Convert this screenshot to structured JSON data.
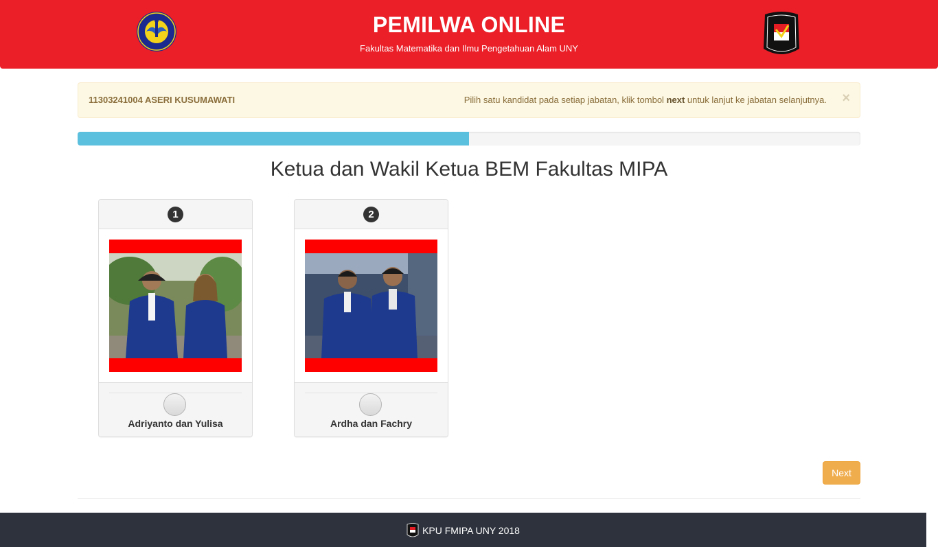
{
  "header": {
    "title": "PEMILWA ONLINE",
    "subtitle": "Fakultas Matematika dan Ilmu Pengetahuan Alam UNY",
    "left_logo_text": "UNIVERSITAS NEGERI YOGYAKARTA",
    "right_logo_text": "PEMILIHAN KOMISI UMUM FMIPA"
  },
  "alert": {
    "user": "11303241004 ASERI KUSUMAWATI",
    "message_before": "Pilih satu kandidat pada setiap jabatan, klik tombol ",
    "message_bold": "next",
    "message_after": " untuk lanjut ke jabatan selanjutnya.",
    "close_label": "×"
  },
  "progress": {
    "value_percent": 50
  },
  "section": {
    "title": "Ketua dan Wakil Ketua BEM Fakultas MIPA"
  },
  "candidates": [
    {
      "number": "1",
      "name": "Adriyanto dan Yulisa"
    },
    {
      "number": "2",
      "name": "Ardha dan Fachry"
    }
  ],
  "actions": {
    "next_label": "Next"
  },
  "footer": {
    "text": "KPU FMIPA UNY 2018"
  },
  "colors": {
    "header_bg": "#ea1f28",
    "progress": "#5bc0de",
    "next_button": "#f0ad4e",
    "footer_bg": "#2d323c"
  },
  "icons": [
    "uny-logo-icon",
    "kpu-fmipa-logo-icon",
    "close-icon",
    "radio-icon"
  ]
}
